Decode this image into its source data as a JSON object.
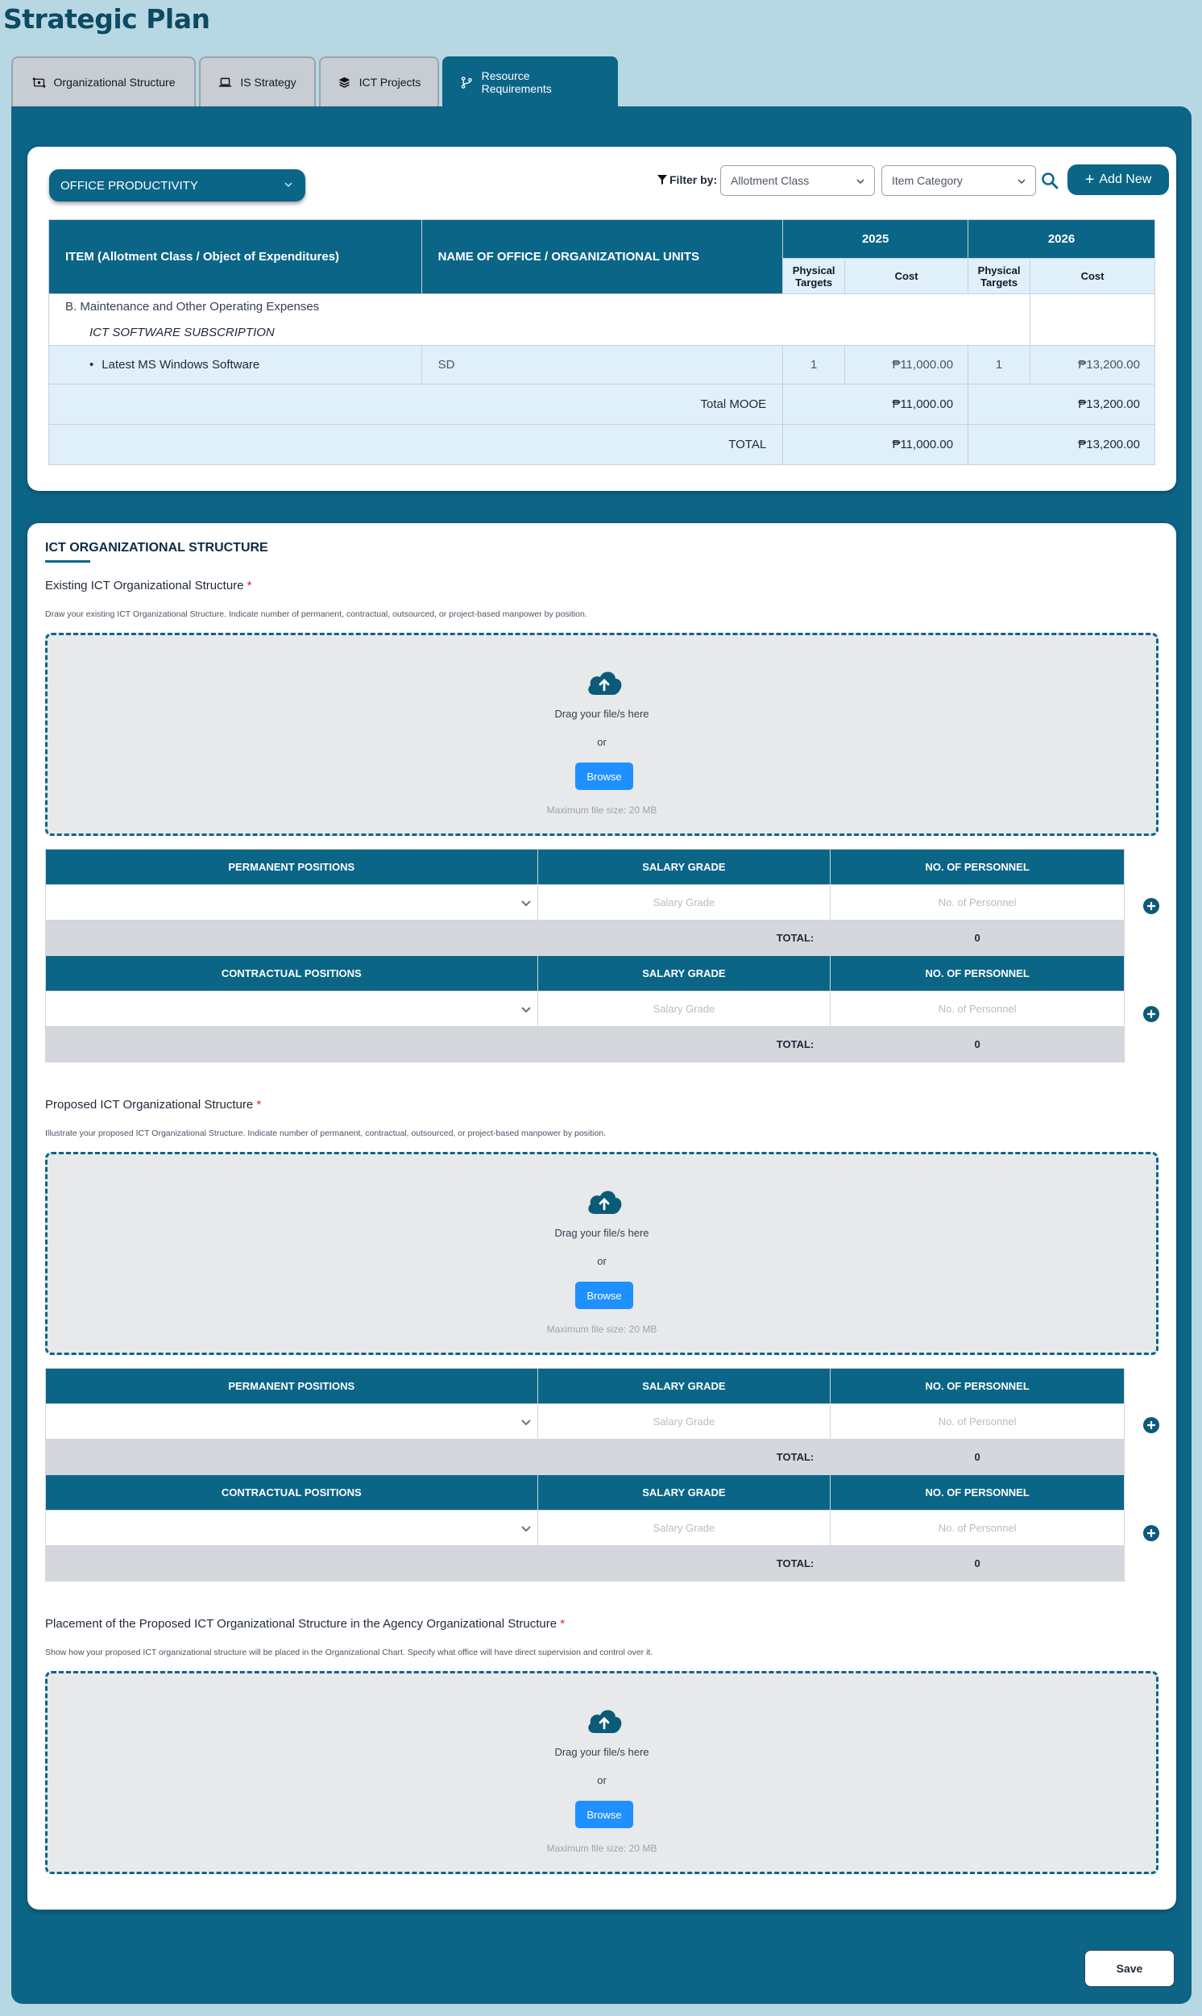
{
  "page": {
    "title": "Strategic Plan"
  },
  "tabs": [
    {
      "label": "Organizational Structure",
      "icon": "org-structure-icon"
    },
    {
      "label": "IS Strategy",
      "icon": "laptop-icon"
    },
    {
      "label": "ICT Projects",
      "icon": "layers-icon"
    },
    {
      "label": "Resource Requirements",
      "icon": "branch-icon",
      "active": true
    }
  ],
  "toolbar": {
    "office": "OFFICE PRODUCTIVITY",
    "filter_label": "Filter by:",
    "allotment_placeholder": "Allotment Class",
    "category_placeholder": "Item Category",
    "add_label": "Add New"
  },
  "budget_table": {
    "col_item": "ITEM (Allotment Class / Object of Expenditures)",
    "col_office": "NAME OF OFFICE / ORGANIZATIONAL UNITS",
    "years": [
      "2025",
      "2026"
    ],
    "sub_targets": "Physical Targets",
    "sub_cost": "Cost",
    "group": "B. Maintenance and Other Operating Expenses",
    "subgroup": "ICT SOFTWARE SUBSCRIPTION",
    "row": {
      "item": "Latest MS Windows Software",
      "office": "SD",
      "t2025": "1",
      "c2025": "₱11,000.00",
      "t2026": "1",
      "c2026": "₱13,200.00"
    },
    "total_mooe": {
      "label": "Total MOOE",
      "c2025": "₱11,000.00",
      "c2026": "₱13,200.00"
    },
    "total": {
      "label": "TOTAL",
      "c2025": "₱11,000.00",
      "c2026": "₱13,200.00"
    }
  },
  "org": {
    "heading": "ICT ORGANIZATIONAL STRUCTURE",
    "existing": {
      "title": "Existing ICT Organizational Structure",
      "desc": "Draw your existing ICT Organizational Structure. Indicate number of permanent, contractual, outsourced, or project-based manpower by position."
    },
    "proposed": {
      "title": "Proposed ICT Organizational Structure",
      "desc": "Illustrate your proposed ICT Organizational Structure. Indicate number of permanent, contractual, outsourced, or project-based manpower by position."
    },
    "placement": {
      "title": "Placement of the Proposed ICT Organizational Structure in the Agency Organizational Structure",
      "desc": "Show how your proposed ICT organizational structure will be placed in the Organizational Chart. Specify what office will have direct supervision and control over it."
    },
    "required_mark": "*"
  },
  "dropzone": {
    "drag_text": "Drag your file/s here",
    "or_text": "or",
    "browse_label": "Browse",
    "max_text": "Maximum file size: 20 MB"
  },
  "positions": {
    "permanent_header": "PERMANENT POSITIONS",
    "contractual_header": "CONTRACTUAL POSITIONS",
    "salary_header": "SALARY GRADE",
    "personnel_header": "NO. OF PERSONNEL",
    "salary_placeholder": "Salary Grade",
    "personnel_placeholder": "No. of Personnel",
    "total_label": "TOTAL:",
    "total_value": "0"
  },
  "footer": {
    "save_label": "Save"
  }
}
